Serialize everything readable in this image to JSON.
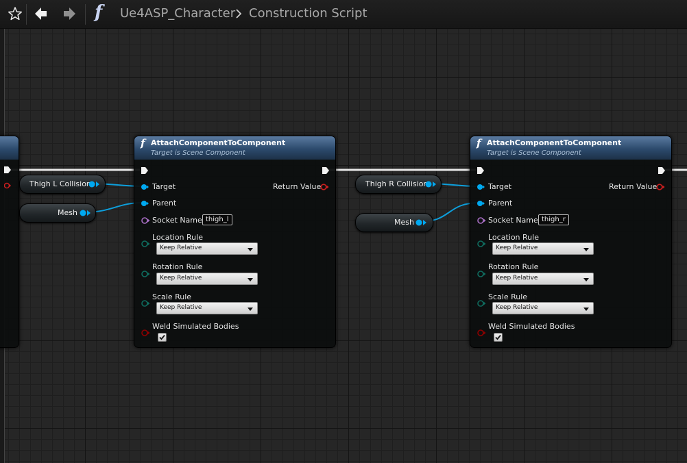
{
  "toolbar": {
    "breadcrumb": [
      "Ue4ASP_Character",
      "Construction Script"
    ],
    "function_glyph": "f"
  },
  "icons": {
    "favorite": "star-icon",
    "back": "back-arrow-icon",
    "forward": "forward-arrow-icon",
    "function": "function-icon",
    "separator": "chevron-right-icon"
  },
  "colors": {
    "exec_pin": "#ffffff",
    "object_pin": "#00a8f0",
    "return_pin": "#cc1f1f",
    "name_pin": "#a86ec4",
    "enum_pin": "#0f6b5e",
    "bool_pin": "#8c0000",
    "node_header": "#2c4a6c"
  },
  "variables": [
    {
      "label": "Thigh L Collision"
    },
    {
      "label": "Mesh"
    },
    {
      "label": "Thigh R Collision"
    },
    {
      "label": "Mesh"
    }
  ],
  "nodes": [
    {
      "title": "AttachComponentToComponent",
      "subtitle": "Target is Scene Component",
      "pins": {
        "target": "Target",
        "parent": "Parent",
        "socket_name": "Socket Name",
        "return_value": "Return Value",
        "location_rule": "Location Rule",
        "rotation_rule": "Rotation Rule",
        "scale_rule": "Scale Rule",
        "weld": "Weld Simulated Bodies"
      },
      "socket_value": "thigh_l",
      "location_value": "Keep Relative",
      "rotation_value": "Keep Relative",
      "scale_value": "Keep Relative",
      "weld_checked": true
    },
    {
      "title": "AttachComponentToComponent",
      "subtitle": "Target is Scene Component",
      "pins": {
        "target": "Target",
        "parent": "Parent",
        "socket_name": "Socket Name",
        "return_value": "Return Value",
        "location_rule": "Location Rule",
        "rotation_rule": "Rotation Rule",
        "scale_rule": "Scale Rule",
        "weld": "Weld Simulated Bodies"
      },
      "socket_value": "thigh_r",
      "location_value": "Keep Relative",
      "rotation_value": "Keep Relative",
      "scale_value": "Keep Relative",
      "weld_checked": true
    }
  ]
}
